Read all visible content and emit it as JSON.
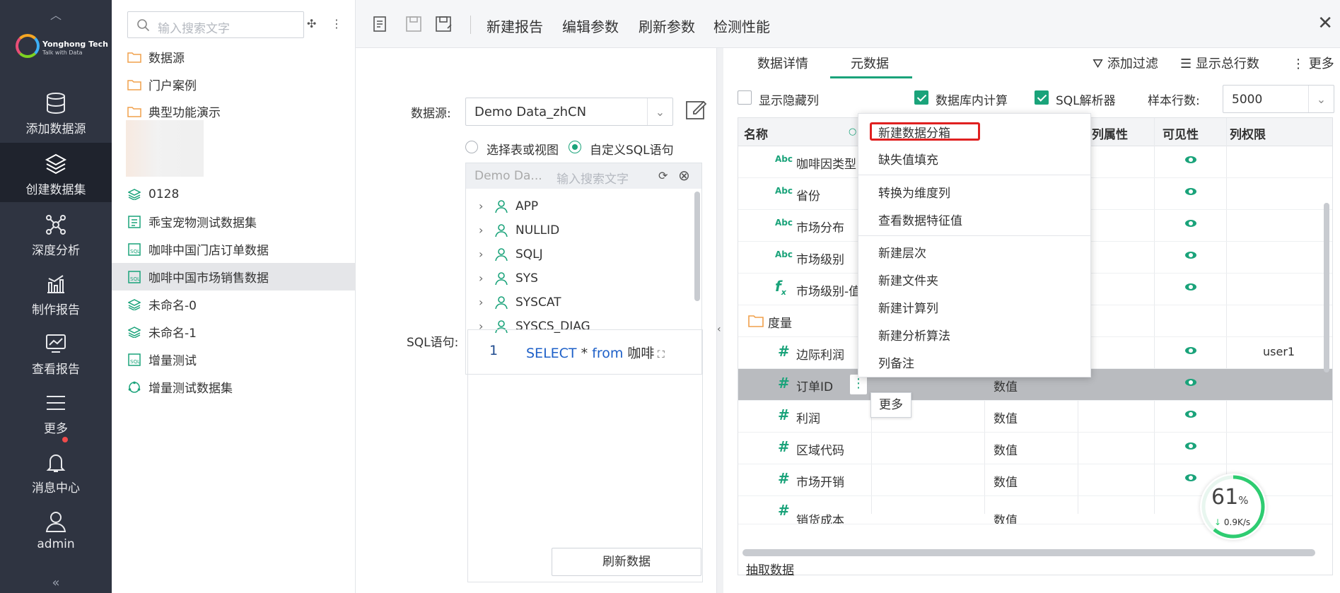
{
  "nav": {
    "logo_title": "Yonghong Tech",
    "logo_sub": "Talk with Data",
    "items": [
      {
        "label": "添加数据源"
      },
      {
        "label": "创建数据集"
      },
      {
        "label": "深度分析"
      },
      {
        "label": "制作报告"
      },
      {
        "label": "查看报告"
      },
      {
        "label": "更多"
      },
      {
        "label": "消息中心"
      },
      {
        "label": "admin"
      }
    ]
  },
  "tree": {
    "search_placeholder": "输入搜索文字",
    "items": [
      {
        "label": "数据源",
        "icon": "folder-icon"
      },
      {
        "label": "门户案例",
        "icon": "folder-icon"
      },
      {
        "label": "典型功能演示",
        "icon": "folder-icon"
      },
      {
        "label": "0128",
        "icon": "dataset-icon"
      },
      {
        "label": "乖宝宠物测试数据集",
        "icon": "dataset-icon"
      },
      {
        "label": "咖啡中国门店订单数据",
        "icon": "sql-dataset-icon"
      },
      {
        "label": "咖啡中国市场销售数据",
        "icon": "sql-dataset-icon"
      },
      {
        "label": "未命名-0",
        "icon": "dataset-icon"
      },
      {
        "label": "未命名-1",
        "icon": "dataset-icon"
      },
      {
        "label": "增量测试",
        "icon": "sql-dataset-icon"
      },
      {
        "label": "增量测试数据集",
        "icon": "combined-dataset-icon"
      }
    ]
  },
  "toolbar": {
    "new_report": "新建报告",
    "edit_params": "编辑参数",
    "refresh_params": "刷新参数",
    "check_perf": "检测性能"
  },
  "config": {
    "datasource_label": "数据源:",
    "datasource_value": "Demo Data_zhCN",
    "radio_table": "选择表或视图",
    "radio_sql": "自定义SQL语句",
    "schema_db": "Demo Da...",
    "schema_search_placeholder": "输入搜索文字",
    "schemas": [
      "APP",
      "NULLID",
      "SQLJ",
      "SYS",
      "SYSCAT",
      "SYSCS_DIAG"
    ],
    "sql_label": "SQL语句:",
    "sql_line_no": "1",
    "sql_kw1": "SELECT",
    "sql_star": " * ",
    "sql_kw2": "from",
    "sql_rest": " 咖啡",
    "refresh_button": "刷新数据"
  },
  "meta": {
    "tab_detail": "数据详情",
    "tab_meta": "元数据",
    "add_filter": "添加过滤",
    "show_total": "显示总行数",
    "more": "更多",
    "show_hidden": "显示隐藏列",
    "db_compute": "数据库内计算",
    "sql_parser": "SQL解析器",
    "sample_rows_label": "样本行数:",
    "sample_rows_value": "5000",
    "columns": {
      "name": "名称",
      "col_prop": "列属性",
      "visibility": "可见性",
      "col_perm": "列权限"
    },
    "rows": [
      {
        "icon": "Abc",
        "name": "咖啡因类型",
        "type": "",
        "perm": ""
      },
      {
        "icon": "Abc",
        "name": "省份",
        "type": "",
        "perm": ""
      },
      {
        "icon": "Abc",
        "name": "市场分布",
        "type": "",
        "perm": ""
      },
      {
        "icon": "Abc",
        "name": "市场级别",
        "type": "",
        "perm": ""
      },
      {
        "icon": "fx",
        "name": "市场级别-值",
        "type": "",
        "perm": ""
      },
      {
        "icon": "folder",
        "name": "度量",
        "type": "",
        "perm": ""
      },
      {
        "icon": "#",
        "name": "边际利润",
        "type": "",
        "perm": "user1"
      },
      {
        "icon": "#",
        "name": "订单ID",
        "type": "数值",
        "perm": ""
      },
      {
        "icon": "#",
        "name": "利润",
        "type": "数值",
        "perm": ""
      },
      {
        "icon": "#",
        "name": "区域代码",
        "type": "数值",
        "perm": ""
      },
      {
        "icon": "#",
        "name": "市场开销",
        "type": "数值",
        "perm": ""
      },
      {
        "icon": "#",
        "name": "销货成本",
        "type": "数值",
        "perm": ""
      }
    ],
    "extract": "抽取数据"
  },
  "context_menu": {
    "items": [
      "新建数据分箱",
      "缺失值填充",
      "转换为维度列",
      "查看数据特征值",
      "新建层次",
      "新建文件夹",
      "新建计算列",
      "新建分析算法",
      "列备注"
    ],
    "tooltip": "更多"
  },
  "gauge": {
    "percent": "61",
    "percent_sign": "%",
    "speed": "0.9K/s"
  },
  "colors": {
    "accent": "#1aa37a",
    "nav_bg": "#2f3441",
    "highlight_box": "#e02020"
  }
}
